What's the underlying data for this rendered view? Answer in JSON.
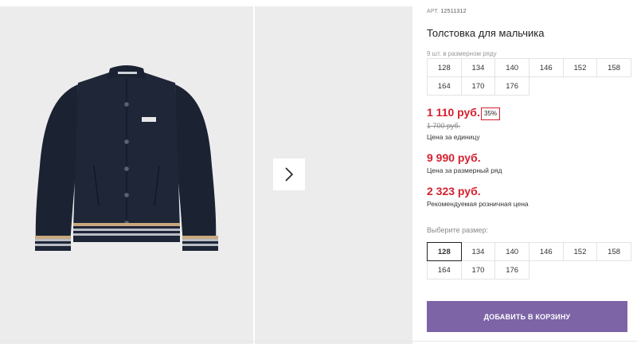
{
  "product": {
    "article_label": "АРТ.",
    "article_number": "12511312",
    "title": "Толстовка для мальчика",
    "size_row_note": "9 шт. в размерном ряду",
    "size_row": [
      "128",
      "134",
      "140",
      "146",
      "152",
      "158",
      "164",
      "170",
      "176"
    ],
    "unit_price": "1 110 руб.",
    "discount": "35%",
    "old_price": "1 700 руб.",
    "unit_price_caption": "Цена за единицу",
    "row_price": "9 990 руб.",
    "row_price_caption": "Цена за размерный ряд",
    "retail_price": "2 323 руб.",
    "retail_price_caption": "Рекомендуемая розничная цена",
    "choose_size_label": "Выберите размер:",
    "size_options": [
      "128",
      "134",
      "140",
      "146",
      "152",
      "158",
      "164",
      "170",
      "176"
    ],
    "selected_size": "128",
    "add_to_cart_label": "ДОБАВИТЬ В КОРЗИНУ"
  },
  "gallery": {
    "next_icon": "chevron-right-icon",
    "image_subject": "navy bomber jacket"
  },
  "colors": {
    "price_red": "#d6202f",
    "button_purple": "#7c64a6"
  }
}
